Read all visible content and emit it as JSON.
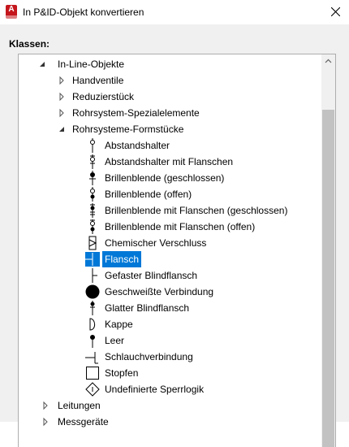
{
  "window": {
    "title": "In P&ID-Objekt konvertieren",
    "app_icon_letter": "A"
  },
  "classes_label": "Klassen:",
  "tree": {
    "in_line": "In-Line-Objekte",
    "handventile": "Handventile",
    "reduzierstueck": "Reduzierstück",
    "rohrsystem_spezial": "Rohrsystem-Spezialelemente",
    "formstuecke": "Rohrsysteme-Formstücke",
    "items": [
      "Abstandshalter",
      "Abstandshalter mit Flanschen",
      "Brillenblende (geschlossen)",
      "Brillenblende (offen)",
      "Brillenblende mit Flanschen (geschlossen)",
      "Brillenblende mit Flanschen (offen)",
      "Chemischer Verschluss",
      "Flansch",
      "Gefaster Blindflansch",
      "Geschweißte Verbindung",
      "Glatter Blindflansch",
      "Kappe",
      "Leer",
      "Schlauchverbindung",
      "Stopfen",
      "Undefinierte Sperrlogik"
    ],
    "leitungen": "Leitungen",
    "messgeraete": "Messgeräte"
  },
  "selected_item": "Flansch"
}
